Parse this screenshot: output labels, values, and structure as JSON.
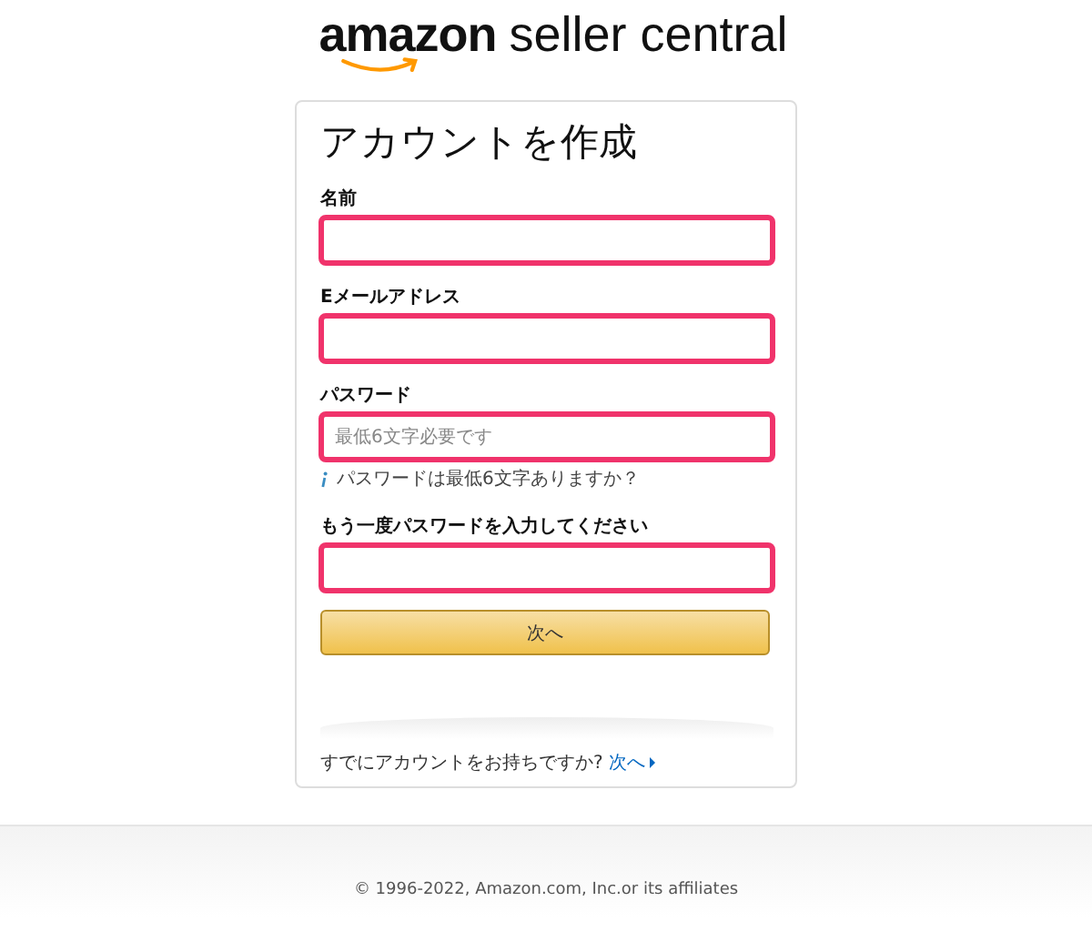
{
  "logo": {
    "brand": "amazon",
    "product": "seller central"
  },
  "form": {
    "title": "アカウントを作成",
    "fields": [
      {
        "label": "名前",
        "error": true
      },
      {
        "label": "Eメールアドレス",
        "error": true
      },
      {
        "label": "パスワード",
        "placeholder": "最低6文字必要です",
        "error": true,
        "hint": "パスワードは最低6文字ありますか？"
      },
      {
        "label": "もう一度パスワードを入力してください",
        "error": true
      }
    ],
    "submit": "次へ",
    "signin_text": "すでにアカウントをお持ちですか?",
    "signin_link": "次へ"
  },
  "footer": {
    "copyright": "© 1996-2022, Amazon.com, Inc.or its affiliates"
  }
}
